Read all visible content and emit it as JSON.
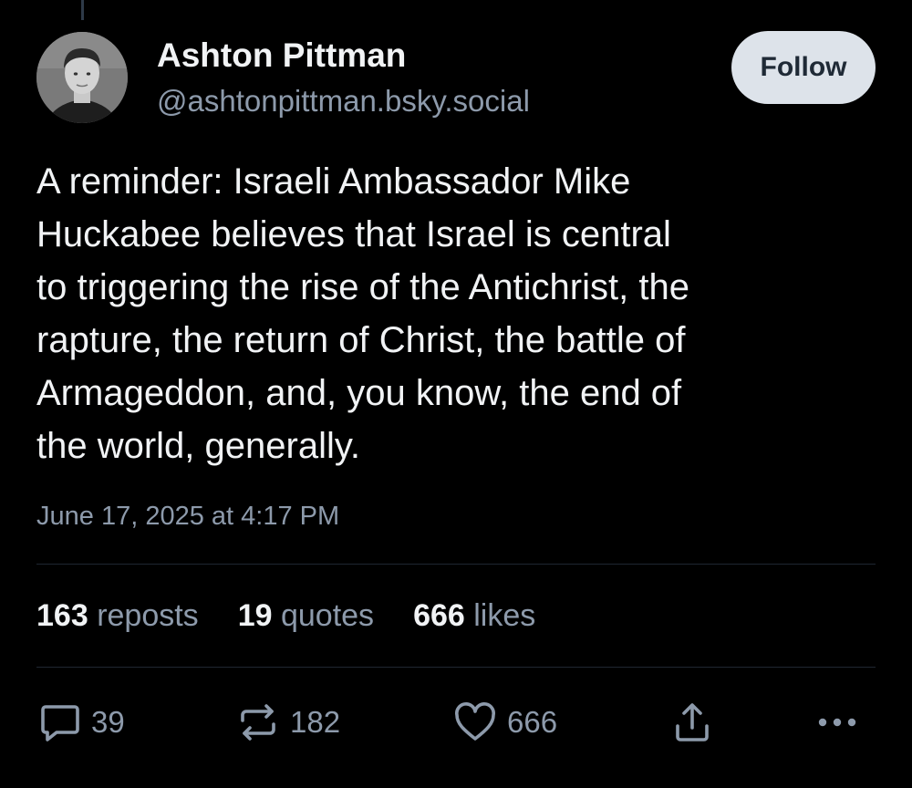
{
  "post": {
    "author": {
      "display_name": "Ashton Pittman",
      "handle": "@ashtonpittman.bsky.social"
    },
    "follow_label": "Follow",
    "text": "A reminder: Israeli Ambassador Mike\nHuckabee believes that Israel is central\nto triggering the rise of the Antichrist, the\nrapture, the return of Christ, the battle of\nArmageddon, and, you know, the end of\nthe world, generally.",
    "timestamp": "June 17, 2025 at 4:17 PM",
    "stats": {
      "reposts": {
        "count": "163",
        "label": "reposts"
      },
      "quotes": {
        "count": "19",
        "label": "quotes"
      },
      "likes": {
        "count": "666",
        "label": "likes"
      }
    },
    "actions": {
      "reply_count": "39",
      "repost_count": "182",
      "like_count": "666"
    }
  },
  "icons": {
    "reply": "speech-bubble-icon",
    "repost": "repost-arrows-icon",
    "like": "heart-icon",
    "share": "share-upload-icon",
    "more": "ellipsis-icon"
  },
  "colors": {
    "background": "#000000",
    "text_primary": "#f1f3f5",
    "text_secondary": "#8d9aab",
    "follow_button_bg": "#dde3ea",
    "divider": "#1f2731"
  }
}
